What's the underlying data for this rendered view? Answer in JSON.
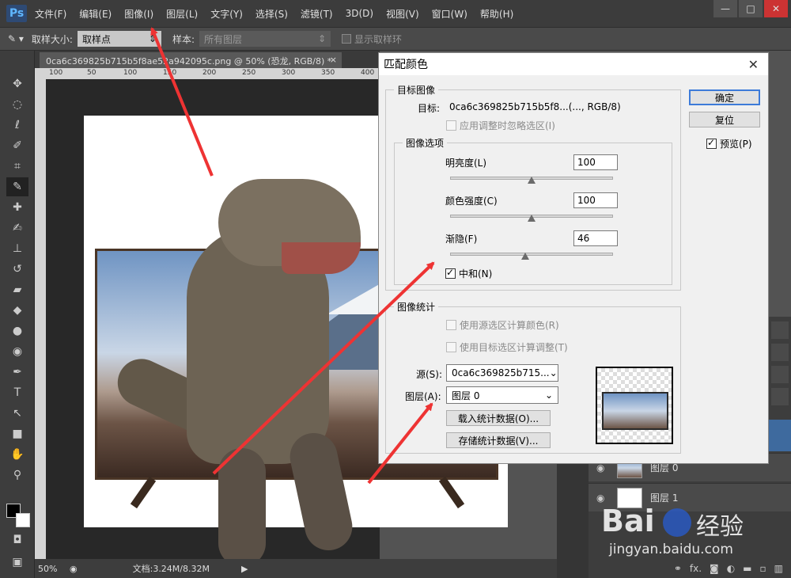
{
  "menu": {
    "logo": "Ps",
    "items": [
      "文件(F)",
      "编辑(E)",
      "图像(I)",
      "图层(L)",
      "文字(Y)",
      "选择(S)",
      "滤镜(T)",
      "3D(D)",
      "视图(V)",
      "窗口(W)",
      "帮助(H)"
    ]
  },
  "window_controls": {
    "minimize": "—",
    "maximize": "□",
    "close": "✕"
  },
  "options": {
    "sample_size_label": "取样大小:",
    "sample_size_value": "取样点",
    "sample_label": "样本:",
    "sample_value": "所有图层",
    "show_ring_label": "显示取样环"
  },
  "document": {
    "tab_title": "0ca6c369825b715b5f8ae52a942095c.png @ 50% (恐龙, RGB/8) *",
    "tab_close": "×",
    "ruler_ticks": [
      "100",
      "50",
      "100",
      "150",
      "200",
      "250",
      "300",
      "350",
      "400",
      "450"
    ]
  },
  "status": {
    "zoom": "50%",
    "doc_info": "文档:3.24M/8.32M"
  },
  "layers": [
    {
      "name": "图层 0"
    },
    {
      "name": "图层 1"
    }
  ],
  "panel_footer_icons": [
    "link-icon",
    "fx-icon",
    "mask-icon",
    "adjustment-icon",
    "folder-icon",
    "new-layer-icon",
    "trash-icon"
  ],
  "panel_footer_fx": "fx.",
  "dialog": {
    "title": "匹配颜色",
    "close": "✕",
    "target_group": "目标图像",
    "target_label": "目标:",
    "target_value": "0ca6c369825b715b5f8...(..., RGB/8)",
    "ignore_selection": "应用调整时忽略选区(I)",
    "image_options_group": "图像选项",
    "luminance_label": "明亮度(L)",
    "luminance_value": "100",
    "luminance_level": 0.5,
    "intensity_label": "颜色强度(C)",
    "intensity_value": "100",
    "intensity_level": 0.5,
    "fade_label": "渐隐(F)",
    "fade_value": "46",
    "fade_level": 0.46,
    "neutralize_label": "中和(N)",
    "neutralize_checked": true,
    "stats_group": "图像统计",
    "use_source_selection": "使用源选区计算颜色(R)",
    "use_target_selection": "使用目标选区计算调整(T)",
    "source_label": "源(S):",
    "source_value": "0ca6c369825b715...",
    "layer_label": "图层(A):",
    "layer_value": "图层 0",
    "load_stats": "载入统计数据(O)...",
    "save_stats": "存储统计数据(V)...",
    "ok": "确定",
    "reset": "复位",
    "preview_label": "预览(P)",
    "preview_checked": true
  },
  "watermark": {
    "brand_a": "Bai",
    "brand_b": "经验",
    "url": "jingyan.baidu.com"
  }
}
